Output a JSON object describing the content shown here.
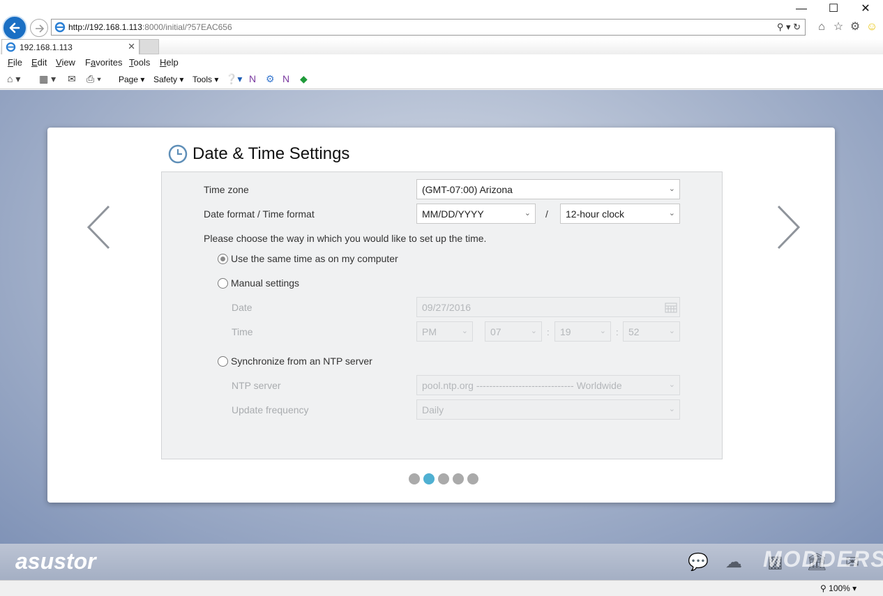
{
  "browser": {
    "url_host": "http://192.168.1.113",
    "url_rest": ":8000/initial/?57EAC656",
    "tab_title": "192.168.1.113",
    "menu": [
      "File",
      "Edit",
      "View",
      "Favorites",
      "Tools",
      "Help"
    ],
    "menu_underline": [
      "F",
      "E",
      "V",
      "a",
      "T",
      "H"
    ],
    "command": {
      "page": "Page",
      "safety": "Safety",
      "tools": "Tools"
    },
    "zoom": "100%"
  },
  "wizard": {
    "title": "Date & Time Settings",
    "timezone_label": "Time zone",
    "timezone_value": "(GMT-07:00) Arizona",
    "format_label": "Date format / Time format",
    "date_format": "MM/DD/YYYY",
    "format_sep": "/",
    "time_format": "12-hour clock",
    "prompt": "Please choose the way in which you would like to set up the time.",
    "options": [
      {
        "label": "Use the same time as on my computer",
        "selected": true
      },
      {
        "label": "Manual settings",
        "selected": false
      },
      {
        "label": "Synchronize from an NTP server",
        "selected": false
      }
    ],
    "manual": {
      "date_label": "Date",
      "date_value": "09/27/2016",
      "time_label": "Time",
      "ampm": "PM",
      "hour": "07",
      "minute": "19",
      "second": "52",
      "time_sep": ":"
    },
    "ntp": {
      "server_label": "NTP server",
      "server_value": "pool.ntp.org ------------------------------ Worldwide",
      "freq_label": "Update frequency",
      "freq_value": "Daily"
    },
    "steps_total": 5,
    "step_active": 2
  },
  "footer": {
    "logo": "asustor",
    "watermark": "MODDERS"
  },
  "colors": {
    "accent": "#4fb0d2",
    "back_button": "#1a6fc4"
  }
}
